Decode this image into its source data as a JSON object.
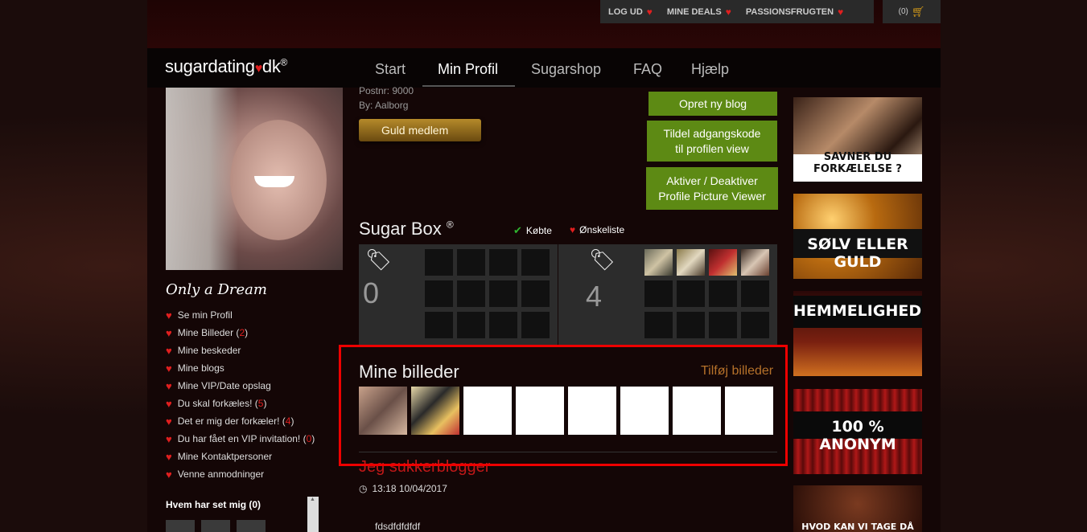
{
  "topbar": {
    "links": [
      {
        "label": "LOG UD"
      },
      {
        "label": "MINE DEALS"
      },
      {
        "label": "PASSIONSFRUGTEN"
      }
    ],
    "cart_count": "(0)"
  },
  "logo": {
    "left": "sugardating",
    "right": "dk",
    "reg": "®"
  },
  "nav": {
    "items": [
      "Start",
      "Min Profil",
      "Sugarshop",
      "FAQ",
      "Hjælp"
    ],
    "active": "Min Profil"
  },
  "profile": {
    "name": "Only a Dream",
    "postnr": "Postnr: 9000",
    "city": "By: Aalborg",
    "membership": "Guld medlem"
  },
  "side_menu": [
    {
      "label": "Se min Profil",
      "count": ""
    },
    {
      "label": "Mine Billeder",
      "count": "2"
    },
    {
      "label": "Mine beskeder",
      "count": ""
    },
    {
      "label": "Mine blogs",
      "count": ""
    },
    {
      "label": "Mine VIP/Date opslag",
      "count": ""
    },
    {
      "label": "Du skal forkæles!",
      "count": "5"
    },
    {
      "label": "Det er mig der forkæler!",
      "count": "4"
    },
    {
      "label": "Du har fået en VIP invitation!",
      "count": "0"
    },
    {
      "label": "Mine Kontaktpersoner",
      "count": ""
    },
    {
      "label": "Venne anmodninger",
      "count": ""
    }
  ],
  "who_seen": "Hvem har set mig (0)",
  "buttons": {
    "new_blog": "Opret ny blog",
    "access_code_1": "Tildel adgangskode",
    "access_code_2": "til profilen view",
    "viewer_1": "Aktiver / Deaktiver",
    "viewer_2": "Profile Picture Viewer"
  },
  "sugarbox": {
    "title": "Sugar Box",
    "reg": "®",
    "bought_label": "Købte",
    "wishlist_label": "Ønskeliste",
    "bought_count": "0",
    "wishlist_count": "4"
  },
  "photos": {
    "title": "Mine billeder",
    "add_label": "Tilføj billeder"
  },
  "blog": {
    "title": "Jeg sukkerblogger",
    "time": "13:18 10/04/2017",
    "body": "fdsdfdfdfdf"
  },
  "ads": [
    {
      "text": "SAVNER DU FORKÆLELSE ?"
    },
    {
      "text": "SØLV ELLER GULD"
    },
    {
      "text": "HEMMELIGHEDER"
    },
    {
      "text": "100 % ANONYM"
    },
    {
      "text": "HVOD KAN VI TAGE DÅ DATE"
    }
  ],
  "colors": {
    "accent_red": "#e01f1f",
    "button_green": "#5d8a14",
    "gold": "#b58a2a",
    "highlight_border": "#ee0000"
  }
}
